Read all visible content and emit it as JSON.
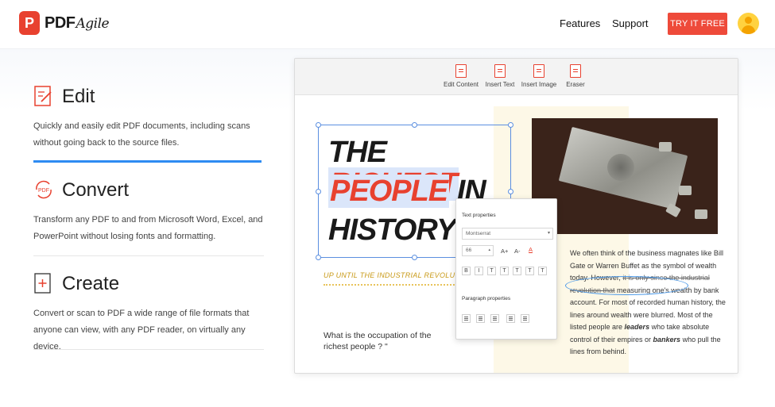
{
  "header": {
    "logo_letter": "P",
    "logo_text": "PDF",
    "logo_script": "Agile",
    "nav": {
      "features": "Features",
      "support": "Support"
    },
    "cta": "TRY IT FREE"
  },
  "features": [
    {
      "title": "Edit",
      "icon": "edit-document-icon",
      "desc1": "Quickly and easily edit PDF documents, including scans",
      "desc2": "without going back to the source files."
    },
    {
      "title": "Convert",
      "icon": "convert-pdf-icon",
      "desc1": "Transform any PDF to and from Microsoft Word, Excel, and",
      "desc2": "PowerPoint without losing fonts and formatting."
    },
    {
      "title": "Create",
      "icon": "create-document-icon",
      "desc1": "Convert or scan to PDF a wide range of file formats that",
      "desc2": "anyone can view, with any PDF reader, on virtually any device."
    }
  ],
  "editor": {
    "tools": [
      {
        "label": "Edit Content",
        "icon": "edit-content-icon"
      },
      {
        "label": "Insert Text",
        "icon": "insert-text-icon"
      },
      {
        "label": "Insert Image",
        "icon": "insert-image-icon"
      },
      {
        "label": "Eraser",
        "icon": "eraser-icon"
      }
    ],
    "headline": {
      "the": "THE",
      "richest": "RICHEST",
      "people": "PEOPLE",
      "in": "IN",
      "history": "HISTORY"
    },
    "caption": "UP UNTIL THE INDUSTRIAL REVOLUTION",
    "question": "What is the occupation of the richest people ? \"",
    "body": {
      "p1": "We often think of the business magnates like Bill Gate or Warren Buffet as the symbol of wealth today. However, ",
      "strike": "it is only since the industrial revolution that",
      "p2": " measuring one's wealth by bank account. For most of recorded human history, the lines around wealth were blurred. Most of the listed people are ",
      "leaders": "leaders",
      "p3": " who take absolute control of their empires or ",
      "bankers": "bankers",
      "p4": " who pull the lines from behind."
    },
    "props": {
      "text_title": "Text properties",
      "font": "Montserrat",
      "size": "66",
      "paragraph_title": "Paragraph properties",
      "buttons": [
        "A+",
        "A-",
        "A",
        "B",
        "I",
        "T",
        "T",
        "T",
        "T",
        "T"
      ]
    }
  }
}
